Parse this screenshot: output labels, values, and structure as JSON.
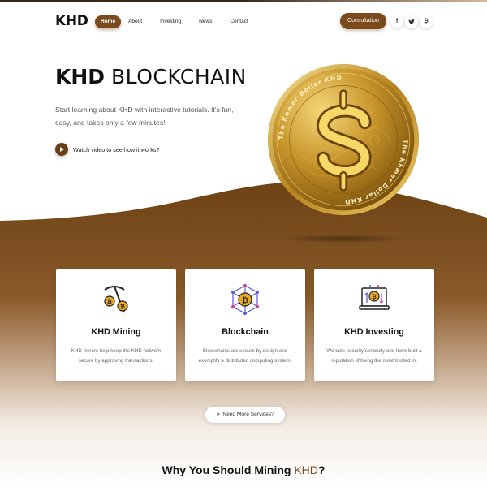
{
  "brand": {
    "logo": "KHD",
    "accent": "#7a4a1c",
    "dark_accent": "#5c3612"
  },
  "nav": {
    "items": [
      {
        "label": "Home",
        "active": true
      },
      {
        "label": "About",
        "active": false
      },
      {
        "label": "Investing",
        "active": false
      },
      {
        "label": "News",
        "active": false
      },
      {
        "label": "Contact",
        "active": false
      }
    ],
    "cta_label": "Consultation",
    "social": [
      {
        "icon": "facebook-icon",
        "glyph": "f"
      },
      {
        "icon": "twitter-icon",
        "glyph": "🐦"
      },
      {
        "icon": "bitcoin-icon",
        "glyph": "₿"
      }
    ]
  },
  "hero": {
    "title_bold": "KHD",
    "title_light": "BLOCKCHAIN",
    "desc_before": "Start learning about ",
    "desc_highlight": "KHD",
    "desc_after": " with interactive tutorials. It's fun, easy, and takes only a few minutes!",
    "watch_label": "Watch video to see how it works?",
    "coin_text": "The Khmer Dollar KHD"
  },
  "services": [
    {
      "icon": "mining-pickaxe-icon",
      "title": "KHD Mining",
      "text": "KHD miners help keep the KHD network secure by approving transactions."
    },
    {
      "icon": "blockchain-network-icon",
      "title": "Blockchain",
      "text": "Blockchains are secure by design and exemplify a distributed computing system."
    },
    {
      "icon": "investing-laptop-icon",
      "title": "KHD Investing",
      "text": "We take security seriously and have built a reputation of being the most trusted in."
    }
  ],
  "more_services_label": "Need More Services?",
  "why": {
    "before": "Why You Should Mining ",
    "highlight": "KHD",
    "after": "?"
  }
}
